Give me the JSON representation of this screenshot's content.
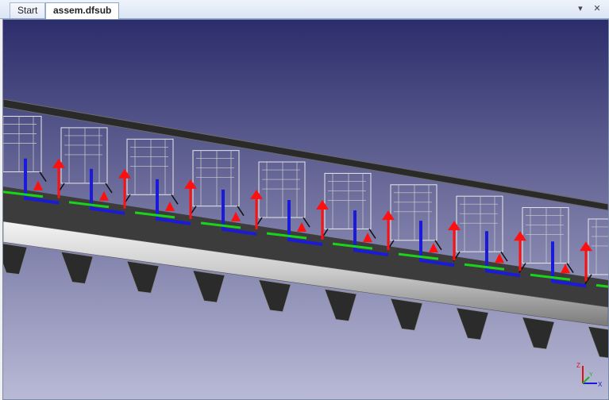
{
  "tabs": [
    {
      "label": "Start",
      "active": false
    },
    {
      "label": "assem.dfsub",
      "active": true
    }
  ],
  "tab_controls": {
    "dropdown": "▾",
    "close": "✕"
  },
  "viewport": {
    "background_top": "#2c2d6b",
    "background_bottom": "#b9bad6",
    "model_color": "#3f3f3f",
    "arrow_colors": {
      "up": "#ff1010",
      "beam": "#1a1ad8",
      "rail": "#19d419"
    }
  },
  "triad": {
    "x_label": "X",
    "y_label": "Y",
    "z_label": "Z"
  }
}
